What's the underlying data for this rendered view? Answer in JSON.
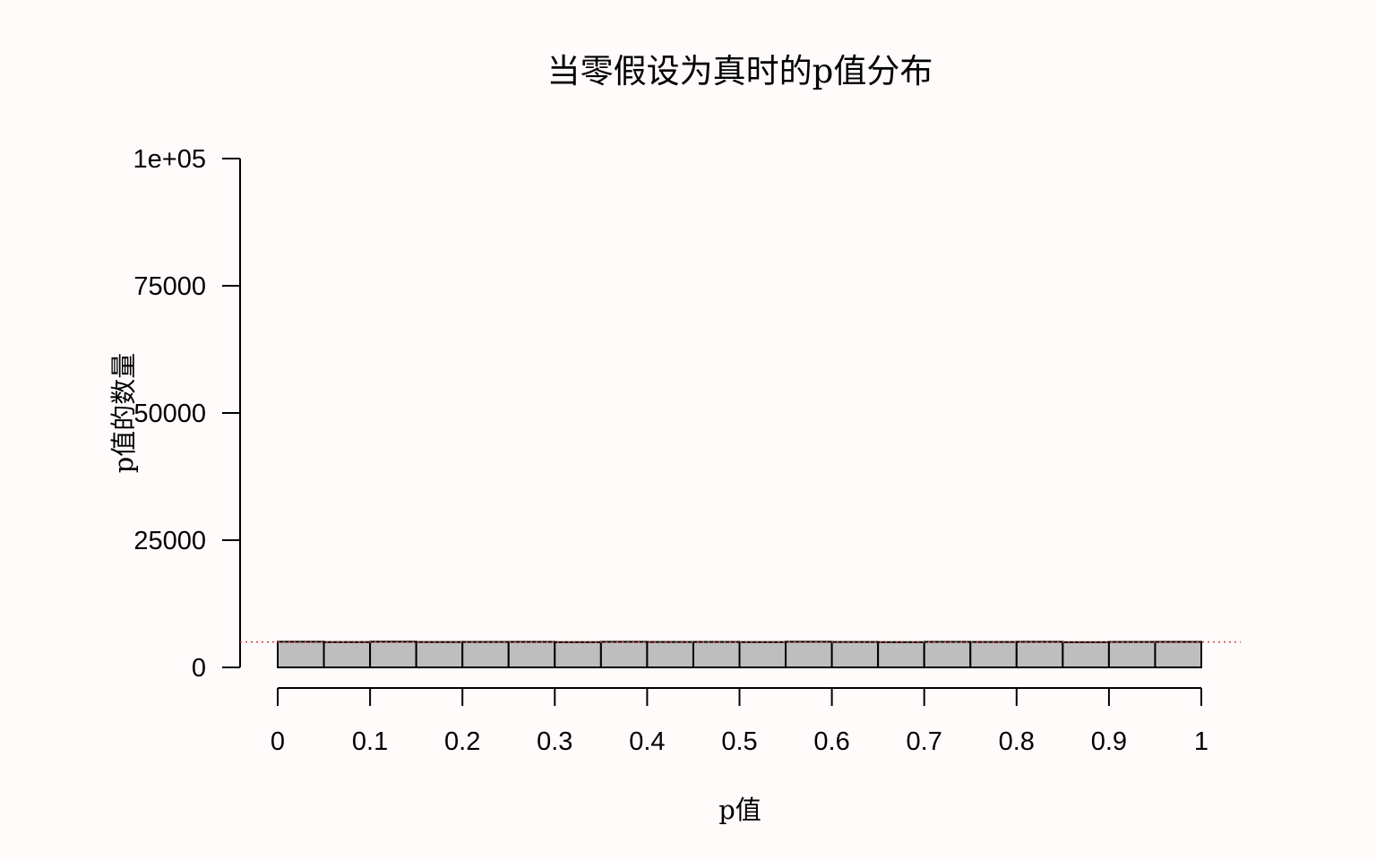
{
  "chart_data": {
    "type": "bar",
    "title": "当零假设为真时的p值分布",
    "xlabel": "p值",
    "ylabel": "p值的数量",
    "xlim": [
      0,
      1
    ],
    "ylim": [
      0,
      100000
    ],
    "x_ticks": [
      "0",
      "0.1",
      "0.2",
      "0.3",
      "0.4",
      "0.5",
      "0.6",
      "0.7",
      "0.8",
      "0.9",
      "1"
    ],
    "y_ticks": [
      "0",
      "25000",
      "50000",
      "75000",
      "1e+05"
    ],
    "bin_width": 0.05,
    "bins": [
      0,
      0.05,
      0.1,
      0.15,
      0.2,
      0.25,
      0.3,
      0.35,
      0.4,
      0.45,
      0.5,
      0.55,
      0.6,
      0.65,
      0.7,
      0.75,
      0.8,
      0.85,
      0.9,
      0.95
    ],
    "values": [
      5040,
      4980,
      5050,
      4990,
      5010,
      5020,
      4970,
      5030,
      5000,
      5010,
      4980,
      5040,
      5000,
      4970,
      5020,
      5000,
      5030,
      4960,
      5010,
      5020
    ],
    "reference_line": {
      "y": 5000,
      "style": "dotted",
      "color": "#dd3333"
    },
    "bar_fill": "#bebebe",
    "bar_stroke": "#000000",
    "background": "#fffbfa",
    "grid": false
  }
}
